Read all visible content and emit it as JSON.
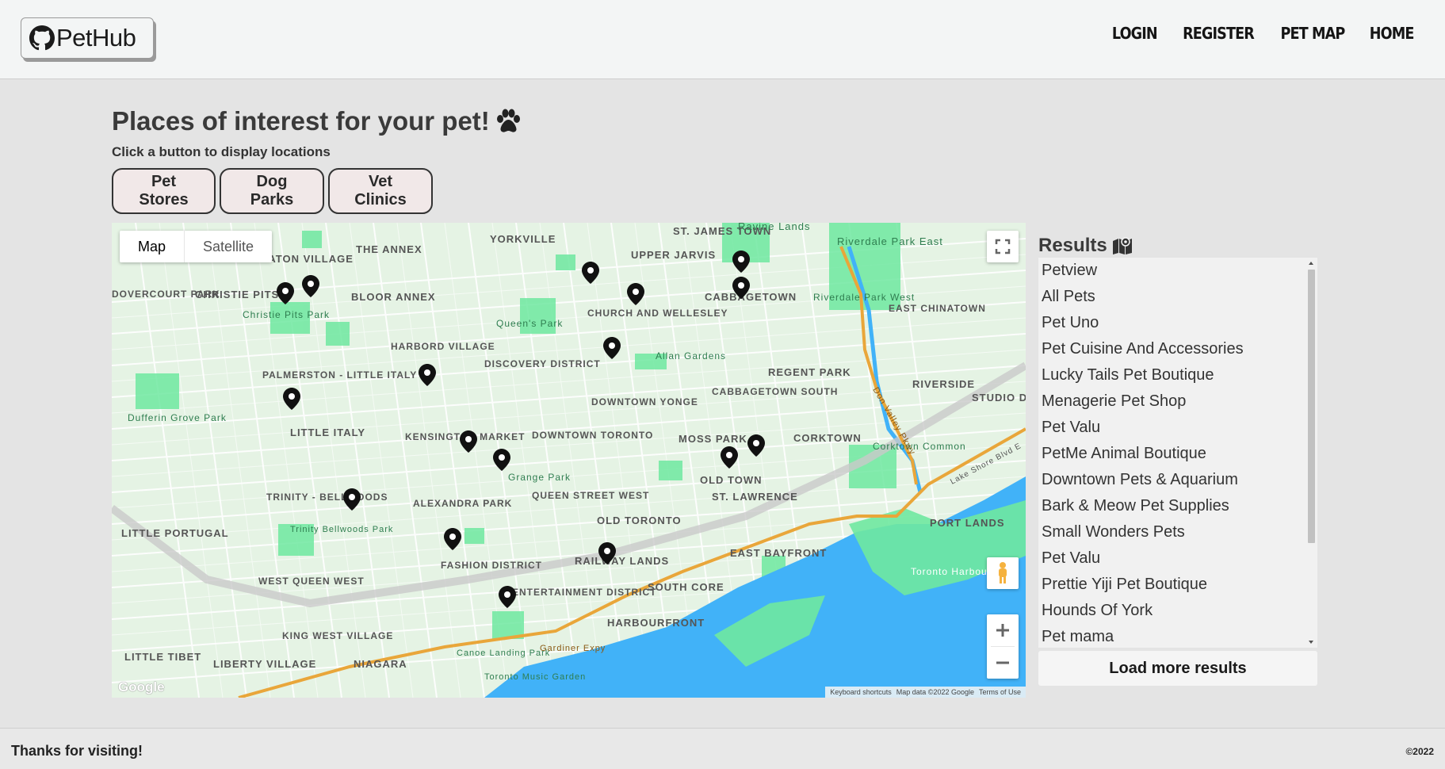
{
  "header": {
    "logo_text": "PetHub",
    "nav": [
      "LOGIN",
      "REGISTER",
      "PET MAP",
      "HOME"
    ]
  },
  "main": {
    "title": "Places of interest for your pet!",
    "subtitle": "Click a button to display locations",
    "category_buttons": [
      "Pet Stores",
      "Dog Parks",
      "Vet Clinics"
    ]
  },
  "map": {
    "type_controls": [
      "Map",
      "Satellite"
    ],
    "attribution": {
      "shortcuts": "Keyboard shortcuts",
      "data": "Map data ©2022 Google",
      "terms": "Terms of Use"
    },
    "google_logo": "Google",
    "labels": [
      "SEATON VILLAGE",
      "THE ANNEX",
      "YORKVILLE",
      "ST. JAMES TOWN",
      "Ravine Lands",
      "Riverdale Park East",
      "UPPER JARVIS",
      "CHRISTIE PITS",
      "BLOOR ANNEX",
      "Christie Pits Park",
      "Queen's Park",
      "CHURCH AND WELLESLEY",
      "CABBAGETOWN",
      "Riverdale Park West",
      "EAST CHINATOWN",
      "HARBORD VILLAGE",
      "Allan Gardens",
      "PALMERSTON - LITTLE ITALY",
      "DISCOVERY DISTRICT",
      "REGENT PARK",
      "RIVERSIDE",
      "DOWNTOWN YONGE",
      "CABBAGETOWN SOUTH",
      "STUDIO D",
      "Dufferin Grove Park",
      "LITTLE ITALY",
      "KENSINGTON MARKET",
      "DOWNTOWN TORONTO",
      "MOSS PARK",
      "CORKTOWN",
      "Corktown Common",
      "Grange Park",
      "OLD TOWN",
      "QUEEN STREET WEST",
      "ST. LAWRENCE",
      "TRINITY - BELLWOODS",
      "ALEXANDRA PARK",
      "OLD TORONTO",
      "LITTLE PORTUGAL",
      "Trinity Bellwoods Park",
      "PORT LANDS",
      "EAST BAYFRONT",
      "FASHION DISTRICT",
      "RAILWAY LANDS",
      "Toronto Harbour",
      "WEST QUEEN WEST",
      "ENTERTAINMENT DISTRICT",
      "SOUTH CORE",
      "KING WEST VILLAGE",
      "HARBOURFRONT",
      "LITTLE TIBET",
      "LIBERTY VILLAGE",
      "NIAGARA",
      "Canoe Landing Park",
      "Toronto Music Garden",
      "DOVERCOURT PARK",
      "Gardiner Expy",
      "Don Valley Pkwy",
      "Lake Shore Blvd E"
    ]
  },
  "results": {
    "heading": "Results",
    "items": [
      "Petview",
      "All Pets",
      "Pet Uno",
      "Pet Cuisine And Accessories",
      "Lucky Tails Pet Boutique",
      "Menagerie Pet Shop",
      "Pet Valu",
      "PetMe Animal Boutique",
      "Downtown Pets & Aquarium",
      "Bark & Meow Pet Supplies",
      "Small Wonders Pets",
      "Pet Valu",
      "Prettie Yiji Pet Boutique",
      "Hounds Of York",
      "Pet mama"
    ],
    "load_more": "Load more results"
  },
  "footer": {
    "message": "Thanks for visiting!",
    "copyright": "©2022"
  },
  "colors": {
    "page_bg": "#e4e4e4",
    "header_bg": "#f3f5f5",
    "button_bg": "#f1e8e8",
    "map_land": "#e5f3e4",
    "map_water": "#41b2f8",
    "map_park": "#6fe8a0",
    "highway": "#e9a63a"
  }
}
